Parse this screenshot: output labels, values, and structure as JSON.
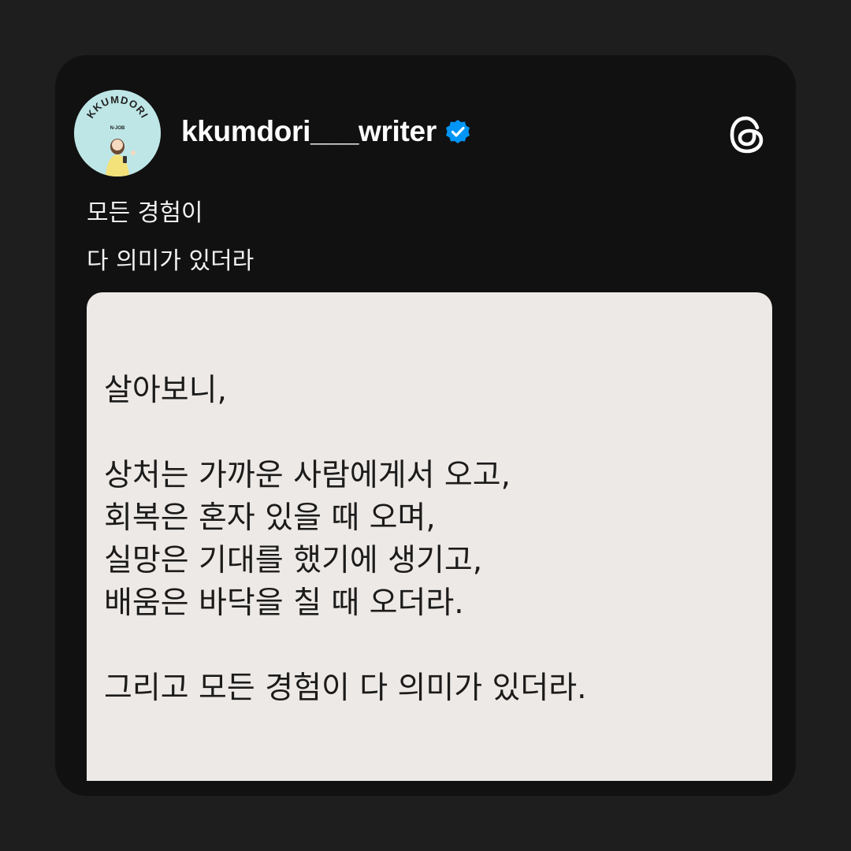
{
  "profile": {
    "username": "kkumdori___writer",
    "verified": true,
    "avatar_badge_text": "KKUMDORI",
    "avatar_sub_text": "N-JOB"
  },
  "brand_icon": "threads-logo-icon",
  "verified_icon": "verified-badge-icon",
  "post": {
    "caption_lines": [
      "모든 경험이",
      "다 의미가 있더라"
    ]
  },
  "media": {
    "intro": "살아보니,",
    "lines": [
      "상처는 가까운 사람에게서 오고,",
      "회복은 혼자 있을 때 오며,",
      "실망은 기대를 했기에 생기고,",
      "배움은 바닥을 칠 때 오더라."
    ],
    "closing": "그리고 모든 경험이 다 의미가 있더라."
  },
  "colors": {
    "page_background": "#1e1e1e",
    "card_background": "#111111",
    "media_background": "#ede9e6",
    "verified_blue": "#0095f6",
    "text_light": "#f2f2f2",
    "text_dark": "#1b1b1b"
  }
}
